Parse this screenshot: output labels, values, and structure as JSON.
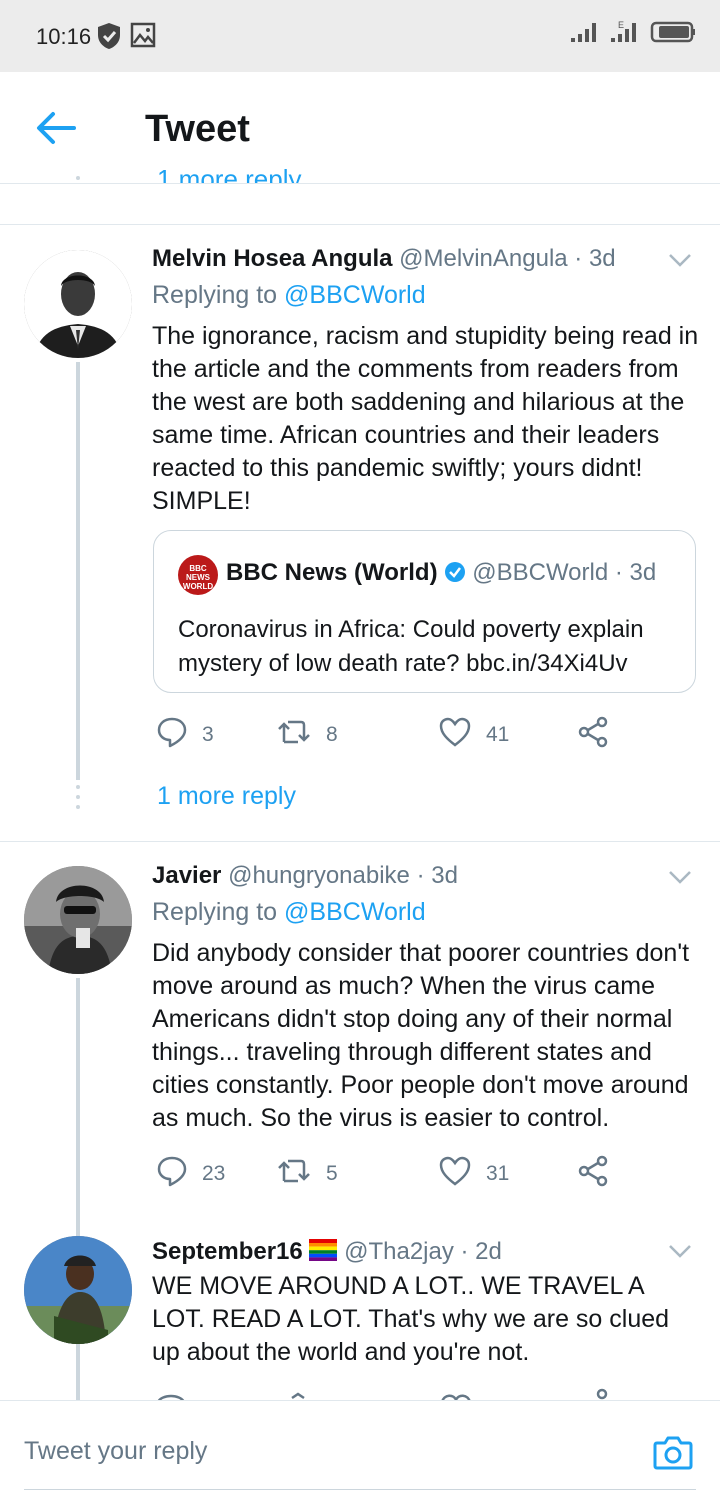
{
  "status_bar": {
    "time": "10:16"
  },
  "header": {
    "title": "Tweet",
    "partial_reply_link": "1 more reply"
  },
  "tweets": [
    {
      "name": "Melvin Hosea Angula",
      "handle": "@MelvinAngula",
      "age": "· 3d",
      "replying_prefix": "Replying to ",
      "replying_to": "@BBCWorld",
      "text": "The ignorance, racism and stupidity being read in the article and the comments from readers from the west are both saddening and hilarious at the same time. African countries and their leaders reacted to this pandemic swiftly; yours didnt! SIMPLE!",
      "quote": {
        "logo": "BBC NEWS WORLD",
        "name": "BBC News (World)",
        "handle": "@BBCWorld",
        "age": "· 3d",
        "text": "Coronavirus in Africa: Could poverty explain mystery of low death rate? bbc.in/34Xi4Uv"
      },
      "replies": "3",
      "retweets": "8",
      "likes": "41",
      "more_replies": "1 more reply"
    },
    {
      "name": "Javier",
      "handle": "@hungryonabike",
      "age": "· 3d",
      "replying_prefix": "Replying to ",
      "replying_to": "@BBCWorld",
      "text": "Did anybody consider that poorer countries don't move around as much? When the virus came Americans didn't stop doing any of their normal things... traveling through different states and cities constantly. Poor people don't move around as much. So the virus is easier to control.",
      "replies": "23",
      "retweets": "5",
      "likes": "31"
    },
    {
      "name": "September16",
      "flag": "🏳️‍🌈",
      "handle": "@Tha2jay",
      "age": "· 2d",
      "text": "WE MOVE AROUND A LOT.. WE TRAVEL A LOT. READ A LOT. That's why we are so clued up about the world and you're not."
    }
  ],
  "compose": {
    "placeholder": "Tweet your reply"
  },
  "colors": {
    "accent": "#1da1f2",
    "muted": "#657786",
    "divider": "#e1e8ed"
  }
}
